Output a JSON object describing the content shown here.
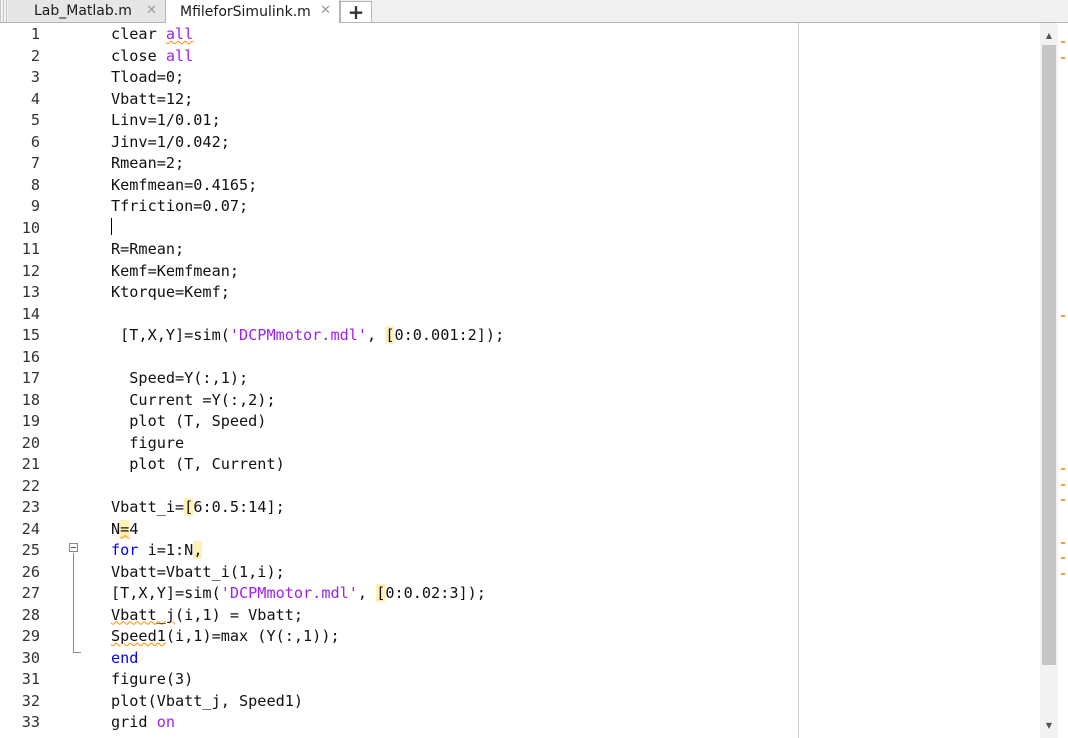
{
  "tabs": [
    {
      "label": "Lab_Matlab.m",
      "active": false,
      "close": "✕"
    },
    {
      "label": "MfileforSimulink.m",
      "active": true,
      "close": "✕"
    }
  ],
  "add_tab_label": "+",
  "icons": {
    "close": "close-icon",
    "add": "plus-icon",
    "fold": "fold-collapse-icon",
    "scroll_up": "arrow-up-icon",
    "scroll_down": "arrow-down-icon"
  },
  "colors": {
    "keyword": "#0000ff",
    "string": "#a020f0",
    "highlight": "#fff0b3",
    "warning": "#ff8c00"
  },
  "lines": [
    {
      "n": "1",
      "segments": [
        {
          "t": "clear "
        },
        {
          "t": "all",
          "c": "kwp",
          "sq": true
        }
      ]
    },
    {
      "n": "2",
      "segments": [
        {
          "t": "close "
        },
        {
          "t": "all",
          "c": "kwp"
        }
      ]
    },
    {
      "n": "3",
      "segments": [
        {
          "t": "Tload=0;"
        }
      ]
    },
    {
      "n": "4",
      "segments": [
        {
          "t": "Vbatt=12;"
        }
      ]
    },
    {
      "n": "5",
      "segments": [
        {
          "t": "Linv=1/0.01;"
        }
      ]
    },
    {
      "n": "6",
      "segments": [
        {
          "t": "Jinv=1/0.042;"
        }
      ]
    },
    {
      "n": "7",
      "segments": [
        {
          "t": "Rmean=2;"
        }
      ]
    },
    {
      "n": "8",
      "segments": [
        {
          "t": "Kemfmean=0.4165;"
        }
      ]
    },
    {
      "n": "9",
      "segments": [
        {
          "t": "Tfriction=0.07;"
        }
      ]
    },
    {
      "n": "10",
      "segments": []
    },
    {
      "n": "11",
      "segments": [
        {
          "t": "R=Rmean;"
        }
      ]
    },
    {
      "n": "12",
      "segments": [
        {
          "t": "Kemf=Kemfmean;"
        }
      ]
    },
    {
      "n": "13",
      "segments": [
        {
          "t": "Ktorque=Kemf;"
        }
      ]
    },
    {
      "n": "14",
      "segments": []
    },
    {
      "n": "15",
      "segments": [
        {
          "t": " [T,X,Y]=sim("
        },
        {
          "t": "'DCPMmotor.mdl'",
          "c": "str"
        },
        {
          "t": ", "
        },
        {
          "t": "[",
          "c": "hl"
        },
        {
          "t": "0:0.001:2]);"
        }
      ]
    },
    {
      "n": "16",
      "segments": []
    },
    {
      "n": "17",
      "segments": [
        {
          "t": "  Speed=Y(:,1);"
        }
      ]
    },
    {
      "n": "18",
      "segments": [
        {
          "t": "  Current =Y(:,2);"
        }
      ]
    },
    {
      "n": "19",
      "segments": [
        {
          "t": "  plot (T, Speed)"
        }
      ]
    },
    {
      "n": "20",
      "segments": [
        {
          "t": "  figure"
        }
      ]
    },
    {
      "n": "21",
      "segments": [
        {
          "t": "  plot (T, Current)"
        }
      ]
    },
    {
      "n": "22",
      "segments": []
    },
    {
      "n": "23",
      "segments": [
        {
          "t": "Vbatt_i="
        },
        {
          "t": "[",
          "c": "hl"
        },
        {
          "t": "6:0.5:14];"
        }
      ]
    },
    {
      "n": "24",
      "segments": [
        {
          "t": "N"
        },
        {
          "t": "=",
          "c": "hl",
          "sq": true
        },
        {
          "t": "4"
        }
      ]
    },
    {
      "n": "25",
      "segments": [
        {
          "t": "for",
          "c": "kw"
        },
        {
          "t": " i=1:N"
        },
        {
          "t": ",",
          "c": "hl"
        }
      ]
    },
    {
      "n": "26",
      "segments": [
        {
          "t": "Vbatt=Vbatt_i(1,i);"
        }
      ]
    },
    {
      "n": "27",
      "segments": [
        {
          "t": "[T,X,Y]=sim("
        },
        {
          "t": "'DCPMmotor.mdl'",
          "c": "str"
        },
        {
          "t": ", "
        },
        {
          "t": "[",
          "c": "hl"
        },
        {
          "t": "0:0.02:3]);"
        }
      ]
    },
    {
      "n": "28",
      "segments": [
        {
          "t": "Vbatt_j",
          "sq": true
        },
        {
          "t": "(i,1) = Vbatt;"
        }
      ]
    },
    {
      "n": "29",
      "segments": [
        {
          "t": "Speed1",
          "sq": true
        },
        {
          "t": "(i,1)=max (Y(:,1));"
        }
      ]
    },
    {
      "n": "30",
      "segments": [
        {
          "t": "end",
          "c": "kw"
        }
      ]
    },
    {
      "n": "31",
      "segments": [
        {
          "t": "figure(3)"
        }
      ]
    },
    {
      "n": "32",
      "segments": [
        {
          "t": "plot(Vbatt_j, Speed1)"
        }
      ]
    },
    {
      "n": "33",
      "segments": [
        {
          "t": "grid "
        },
        {
          "t": "on",
          "c": "kwp"
        }
      ]
    }
  ]
}
